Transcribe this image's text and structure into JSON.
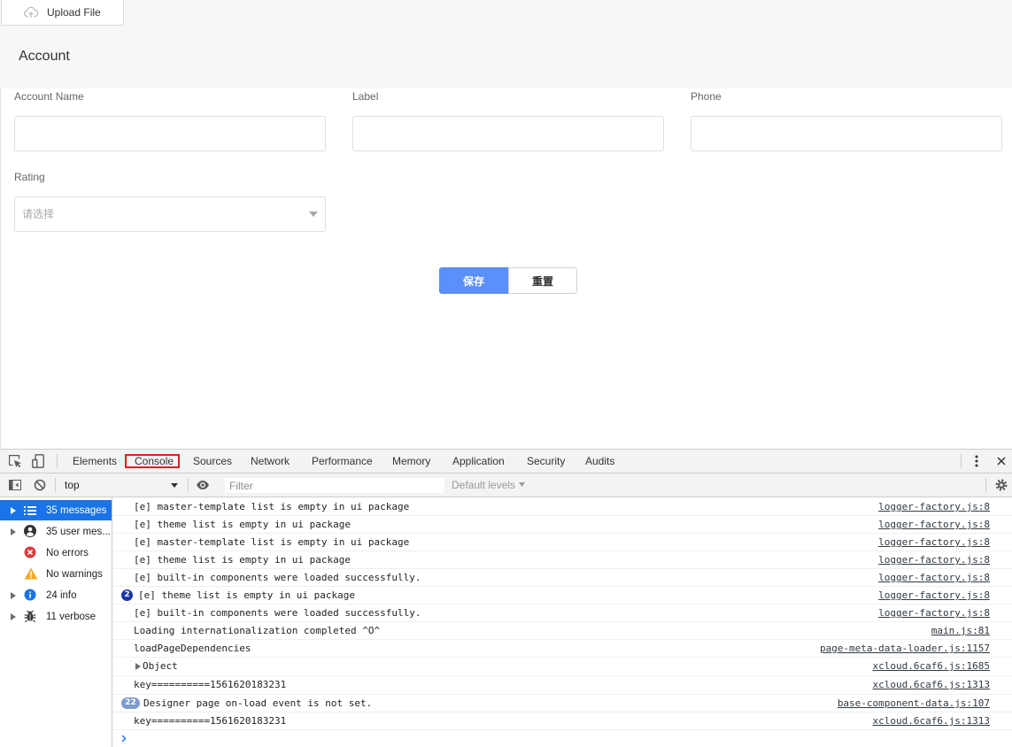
{
  "app": {
    "upload_button": {
      "label": "Upload File",
      "icon": "cloud-upload-icon"
    },
    "section_title": "Account",
    "form": {
      "account_name": {
        "label": "Account Name",
        "value": ""
      },
      "label": {
        "label": "Label",
        "value": ""
      },
      "phone": {
        "label": "Phone",
        "value": ""
      },
      "rating": {
        "label": "Rating",
        "placeholder": "请选择",
        "icon": "caret-down-icon"
      }
    },
    "actions": {
      "save": "保存",
      "reset": "重置"
    },
    "colors": {
      "primary": "#5b8ff9",
      "header_bg": "#f7f7f7",
      "input_border": "#dcdfe6"
    }
  },
  "devtools": {
    "toolbar": {
      "inspect_icon": "inspect-element-icon",
      "device_icon": "device-toolbar-icon",
      "tabs": [
        "Elements",
        "Console",
        "Sources",
        "Network",
        "Performance",
        "Memory",
        "Application",
        "Security",
        "Audits"
      ],
      "active_tab_index": 1,
      "more_icon": "kebab-menu-icon",
      "close_icon": "close-icon"
    },
    "console_toolbar": {
      "sidebar_icon": "sidebar-toggle-icon",
      "clear_icon": "clear-console-icon",
      "context": "top",
      "live_expression_icon": "eye-icon",
      "filter_placeholder": "Filter",
      "filter_value": "",
      "levels": "Default levels",
      "settings_icon": "gear-icon"
    },
    "sidebar": {
      "selected_index": 0,
      "items": [
        {
          "label": "35 messages",
          "icon": "list-icon",
          "expandable": true
        },
        {
          "label": "35 user mes...",
          "icon": "user-icon",
          "expandable": true
        },
        {
          "label": "No errors",
          "icon": "error-icon",
          "expandable": false
        },
        {
          "label": "No warnings",
          "icon": "warning-icon",
          "expandable": false
        },
        {
          "label": "24 info",
          "icon": "info-icon",
          "expandable": true
        },
        {
          "label": "11 verbose",
          "icon": "bug-icon",
          "expandable": true
        }
      ]
    },
    "messages": [
      {
        "text": "[e] master-template list is empty in ui package",
        "source": "logger-factory.js:8"
      },
      {
        "text": "[e] theme list is empty in ui package",
        "source": "logger-factory.js:8"
      },
      {
        "text": "[e] master-template list is empty in ui package",
        "source": "logger-factory.js:8"
      },
      {
        "text": "[e] theme list is empty in ui package",
        "source": "logger-factory.js:8"
      },
      {
        "text": "[e] built-in components were loaded successfully.",
        "source": "logger-factory.js:8"
      },
      {
        "text": "[e] theme list is empty in ui package",
        "source": "logger-factory.js:8",
        "repeat_count": "2"
      },
      {
        "text": "[e] built-in components were loaded successfully.",
        "source": "logger-factory.js:8"
      },
      {
        "text": "Loading internationalization completed ^O^",
        "source": "main.js:81"
      },
      {
        "text": "loadPageDependencies",
        "source": "page-meta-data-loader.js:1157"
      },
      {
        "text": "Object",
        "source": "xcloud.6caf6.js:1685",
        "expandable": true
      },
      {
        "text": "key==========1561620183231",
        "source": "xcloud.6caf6.js:1313"
      },
      {
        "text": "Designer page on-load event is not set.",
        "source": "base-component-data.js:107",
        "repeat_count": "22"
      },
      {
        "text": "key==========1561620183231",
        "source": "xcloud.6caf6.js:1313"
      }
    ],
    "colors": {
      "accent": "#1a73e8",
      "annotation": "#dd1f1f",
      "error": "#e0393e",
      "warning": "#f2ab26",
      "repeat_badge": "#1a35a8",
      "repeat_badge_muted": "#7f9bcc"
    }
  }
}
